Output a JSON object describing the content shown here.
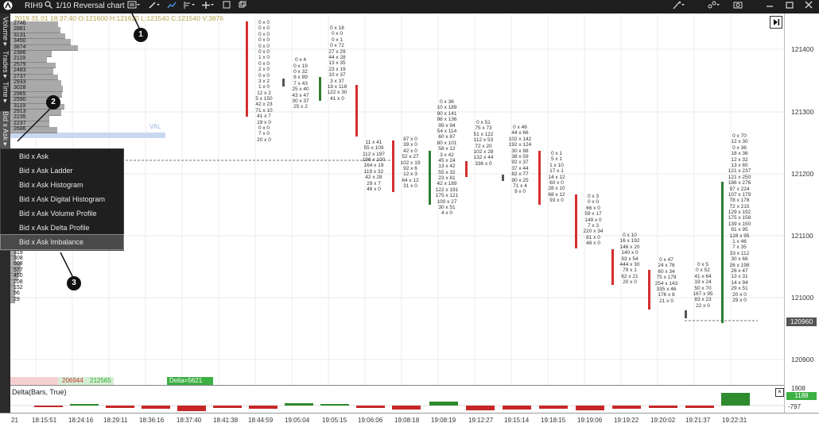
{
  "toolbar": {
    "symbol": "RIH9",
    "chart_type": "1/10 Reversal chart",
    "icons": [
      "logo-icon",
      "search-icon",
      "template-icon",
      "pencil-icon",
      "indicator-icon",
      "align-icon",
      "crosshair-icon",
      "square-icon",
      "magic-icon",
      "link-icon",
      "camera-icon",
      "minimize-icon",
      "restore-icon",
      "close-icon"
    ]
  },
  "ohlc": "2019.31.01 18:37:40  O:121600  H:121620  L:121540  C:121540  V:3876",
  "left_tabs": [
    "Volume ▸",
    "Trades ▸",
    "Time ▸",
    "Bid x Ask ▸"
  ],
  "volume_profile": [
    "2746",
    "2881",
    "3131",
    "3450",
    "3874",
    "2386",
    "2119",
    "2579",
    "2483",
    "2737",
    "2933",
    "3028",
    "2965",
    "2590",
    "3119",
    "2913",
    "2235",
    "2237",
    "2686",
    "",
    "",
    "",
    "",
    "",
    "",
    "",
    "",
    "",
    "",
    "",
    "",
    "",
    "",
    "",
    "",
    "",
    "900",
    "266",
    "732",
    "319",
    "308",
    "608",
    "577",
    "450",
    "208",
    "152",
    "56",
    "29"
  ],
  "val_label": "VAL",
  "price_axis": {
    "labels": [
      "121400",
      "121300",
      "121200",
      "121100",
      "121000",
      "120900"
    ],
    "current": "120960"
  },
  "menu": {
    "items": [
      "Bid x Ask",
      "Bid x Ask Ladder",
      "Bid x Ask Histogram",
      "Bid x Ask Digital Histogram",
      "Bid x Ask Volume Profile",
      "Bid x Ask Delta Profile",
      "Bid x Ask Imbalance"
    ],
    "selected": 6
  },
  "callouts": [
    "1",
    "2",
    "3"
  ],
  "bottom_info": {
    "left_red": "206944",
    "left_green": "212565",
    "delta": "Delta=5621"
  },
  "delta_panel": {
    "title": "Delta(Bars, True)",
    "axis_top": "1908",
    "axis_current": "1188",
    "axis_bottom": "-797"
  },
  "time_axis": [
    "21",
    "18:15:51",
    "18:24:16",
    "18:29:11",
    "18:36:16",
    "18:37:40",
    "18:41:38",
    "18:44:59",
    "19:05:04",
    "19:05:15",
    "19:06:06",
    "19:08:18",
    "19:08:19",
    "19:12:27",
    "19:15:14",
    "19:18:15",
    "19:19:06",
    "19:19:22",
    "19:20:02",
    "19:21:37",
    "19:22:31"
  ],
  "footprints": [
    {
      "rows": [
        "0 x 0",
        "0 x 0",
        "0 x 0",
        "0 x 0",
        "0 x 0",
        "0 x 0",
        "1 x 0",
        "0 x 0",
        "2 x 0",
        "0 x 0",
        "3 x 2",
        "1 x 0",
        "12 x 2",
        "5 x 150",
        "42 x 23",
        "71 x 10",
        "41 x 7",
        "19 x 0",
        "0 x 0",
        "7 x 0",
        "20 x 0"
      ]
    },
    {
      "rows": [
        "",
        "",
        "",
        "0 x 4",
        "0 x 19",
        "0 x 32",
        "6 x 89",
        "7 x 43",
        "25 x 40",
        "43 x 47",
        "30 x 37",
        "25 x 2"
      ]
    },
    {
      "rows": [
        "0 x 18",
        "0 x 0",
        "0 x 1",
        "0 x 72",
        "27 x 29",
        "44 x 28",
        "13 x 35",
        "23 x 19",
        "10 x 37",
        "3 x 37",
        "18 x 118",
        "122 x 30",
        "41 x 0"
      ]
    },
    {
      "rows": [
        "",
        "",
        "",
        "",
        "",
        "",
        "",
        "",
        "",
        "",
        "11 x 41",
        "55 x 109",
        "112 x 197",
        "196 x 100",
        "164 x 19",
        "119 x 32",
        "42 x 28",
        "29 x 7",
        "46 x 0"
      ]
    },
    {
      "rows": [
        "87 x 0",
        "39 x 0",
        "42 x 0",
        "52 x 27",
        "102 x 19",
        "92 x 6",
        "12 x 3",
        "64 x 12",
        "31 x 0"
      ]
    },
    {
      "rows": [
        "0 x 36",
        "10 x 189",
        "90 x 141",
        "98 x 136",
        "99 x 94",
        "54 x 114",
        "60 x 87",
        "80 x 101",
        "58 x 12",
        "3 x 42",
        "45 x 24",
        "13 x 42",
        "55 x 32",
        "23 x 81",
        "42 x 189",
        "122 x 191",
        "175 x 121",
        "100 x 27",
        "30 x 51",
        "4 x 0"
      ]
    },
    {
      "rows": [
        "0 x 51",
        "75 x 73",
        "51 x 122",
        "112 x 53",
        "72 x 20",
        "102 x 28",
        "132 x 44",
        "336 x 0"
      ]
    },
    {
      "rows": [
        "0 x 46",
        "44 x 66",
        "102 x 142",
        "192 x 124",
        "30 x 88",
        "38 x 59",
        "92 x 37",
        "37 x 44",
        "82 x 77",
        "90 x 25",
        "71 x 4",
        "9 x 0"
      ]
    },
    {
      "rows": [
        "0 x 1",
        "5 x 1",
        "1 x 10",
        "17 x 1",
        "14 x 12",
        "60 x 0",
        "28 x 10",
        "68 x 12",
        "93 x 0"
      ]
    },
    {
      "rows": [
        "0 x 3",
        "0 x 0",
        "66 x 0",
        "59 x 17",
        "149 x 0",
        "7 x 3",
        "220 x 34",
        "81 x 0",
        "48 x 0"
      ]
    },
    {
      "rows": [
        "0 x 10",
        "16 x 192",
        "146 x 20",
        "140 x 0",
        "93 x 54",
        "444 x 30",
        "79 x 1",
        "62 x 21",
        "20 x 0"
      ]
    },
    {
      "rows": [
        "0 x 47",
        "24 x 76",
        "60 x 34",
        "75 x 179",
        "254 x 143",
        "335 x 46",
        "176 x 8",
        "21 x 0"
      ]
    },
    {
      "rows": [
        "0 x 5",
        "0 x 52",
        "41 x 64",
        "19 x 24",
        "50 x 70",
        "167 x 95",
        "83 x 23",
        "22 x 0"
      ]
    },
    {
      "rows": [
        "0 x 70",
        "12 x 30",
        "0 x 36",
        "18 x 36",
        "12 x 32",
        "13 x 65",
        "121 x 237",
        "121 x 250",
        "186 x 276",
        "97 x 224",
        "107 x 179",
        "78 x 178",
        "72 x 215",
        "129 x 192",
        "175 x 158",
        "139 x 150",
        "91 x 95",
        "128 x 95",
        "1 x 46",
        "7 x 35",
        "33 x 112",
        "30 x 66",
        "26 x 198",
        "26 x 47",
        "13 x 31",
        "14 x 94",
        "29 x 51",
        "20 x 0",
        "29 x 0"
      ]
    }
  ]
}
